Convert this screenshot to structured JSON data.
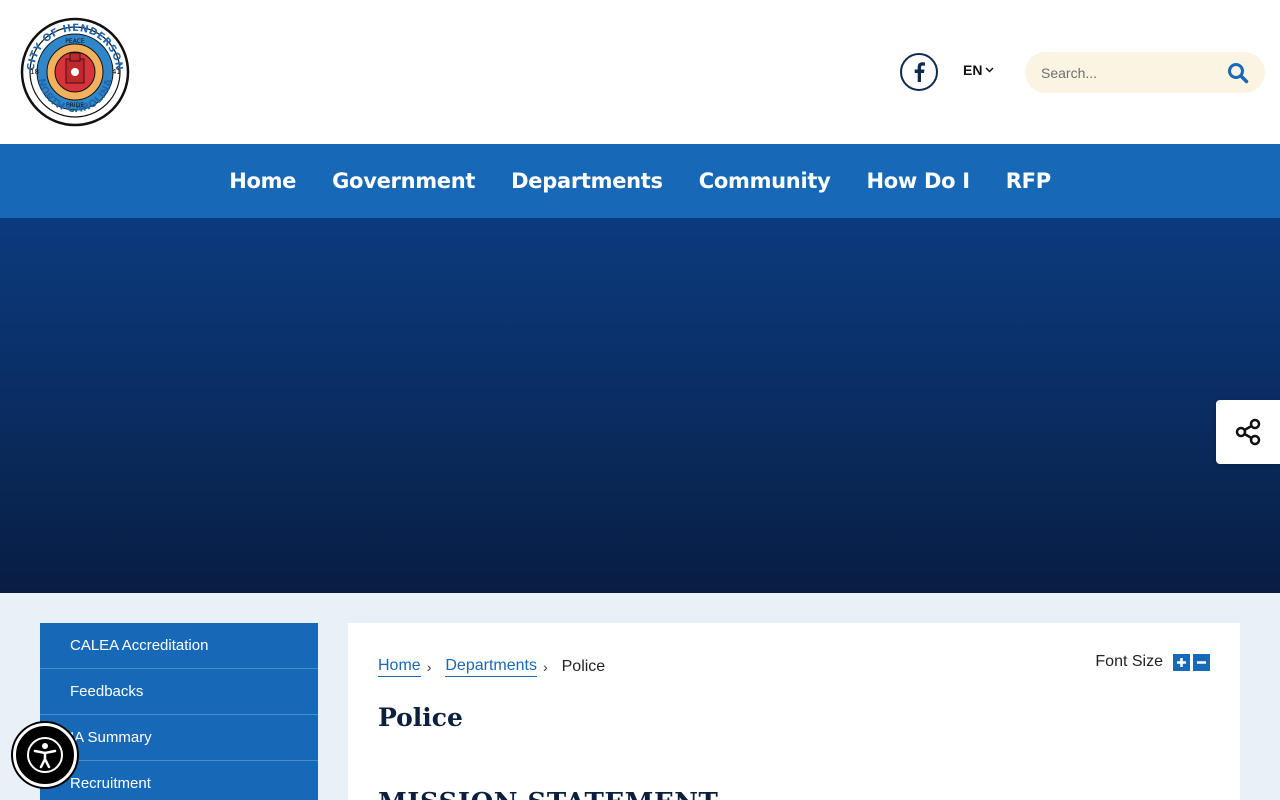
{
  "header": {
    "logo": {
      "ring_top": "CITY OF HENDERSON",
      "ring_bottom": "NORTH CAROLINA",
      "words": [
        "PEACE",
        "PROGRESS",
        "PROSPERITY",
        "PRIDE"
      ],
      "year_left": "18",
      "year_right": "41"
    },
    "facebook_icon": "facebook-f",
    "language": "EN",
    "search_placeholder": "Search..."
  },
  "nav": {
    "items": [
      "Home",
      "Government",
      "Departments",
      "Community",
      "How Do I",
      "RFP"
    ]
  },
  "sidebar": {
    "items": [
      "CALEA Accreditation",
      "Feedbacks",
      "IA Summary",
      "Recruitment"
    ]
  },
  "breadcrumb": {
    "home": "Home",
    "departments": "Departments",
    "current": "Police"
  },
  "font_size_label": "Font Size",
  "page_title": "Police",
  "section_title": "MISSION STATEMENT",
  "colors": {
    "primary": "#1769b7",
    "dark_navy": "#0c1f3d",
    "hero_top": "#0c3a7e",
    "hero_bottom": "#081d42",
    "search_bg": "#fbf4e2"
  }
}
